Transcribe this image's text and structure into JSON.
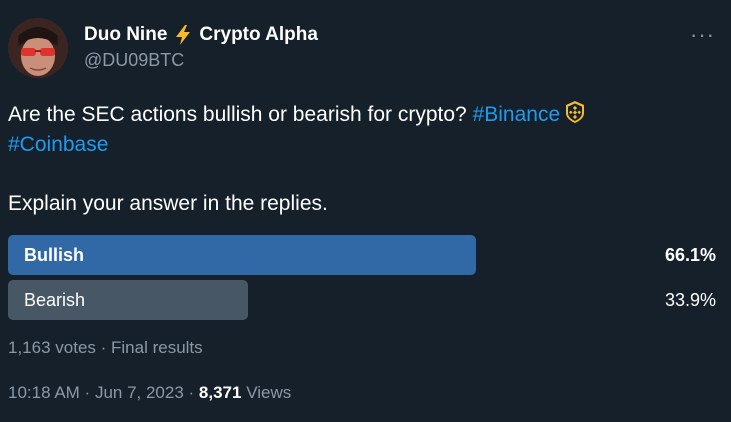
{
  "author": {
    "display_name": "Duo Nine",
    "display_name_suffix": "Crypto Alpha",
    "handle": "@DU09BTC"
  },
  "tweet": {
    "text_line1": "Are the SEC actions bullish or bearish for crypto? ",
    "hashtag1": "#Binance",
    "hashtag2": "#Coinbase",
    "text_line2": "Explain your answer in the replies."
  },
  "poll": {
    "options": [
      {
        "label": "Bullish",
        "percent": "66.1%",
        "fraction": 0.661,
        "color": "#3069a6"
      },
      {
        "label": "Bearish",
        "percent": "33.9%",
        "fraction": 0.339,
        "color": "#475766"
      }
    ],
    "votes": "1,163 votes",
    "separator": " · ",
    "status": "Final results"
  },
  "meta": {
    "time": "10:18 AM",
    "date": "Jun 7, 2023",
    "views_count": "8,371",
    "views_label": "Views"
  },
  "colors": {
    "background": "#15202b",
    "text": "#ffffff",
    "secondary_text": "#8b98a5",
    "link": "#1d9bf0",
    "binance_yellow": "#f3ba2f"
  }
}
